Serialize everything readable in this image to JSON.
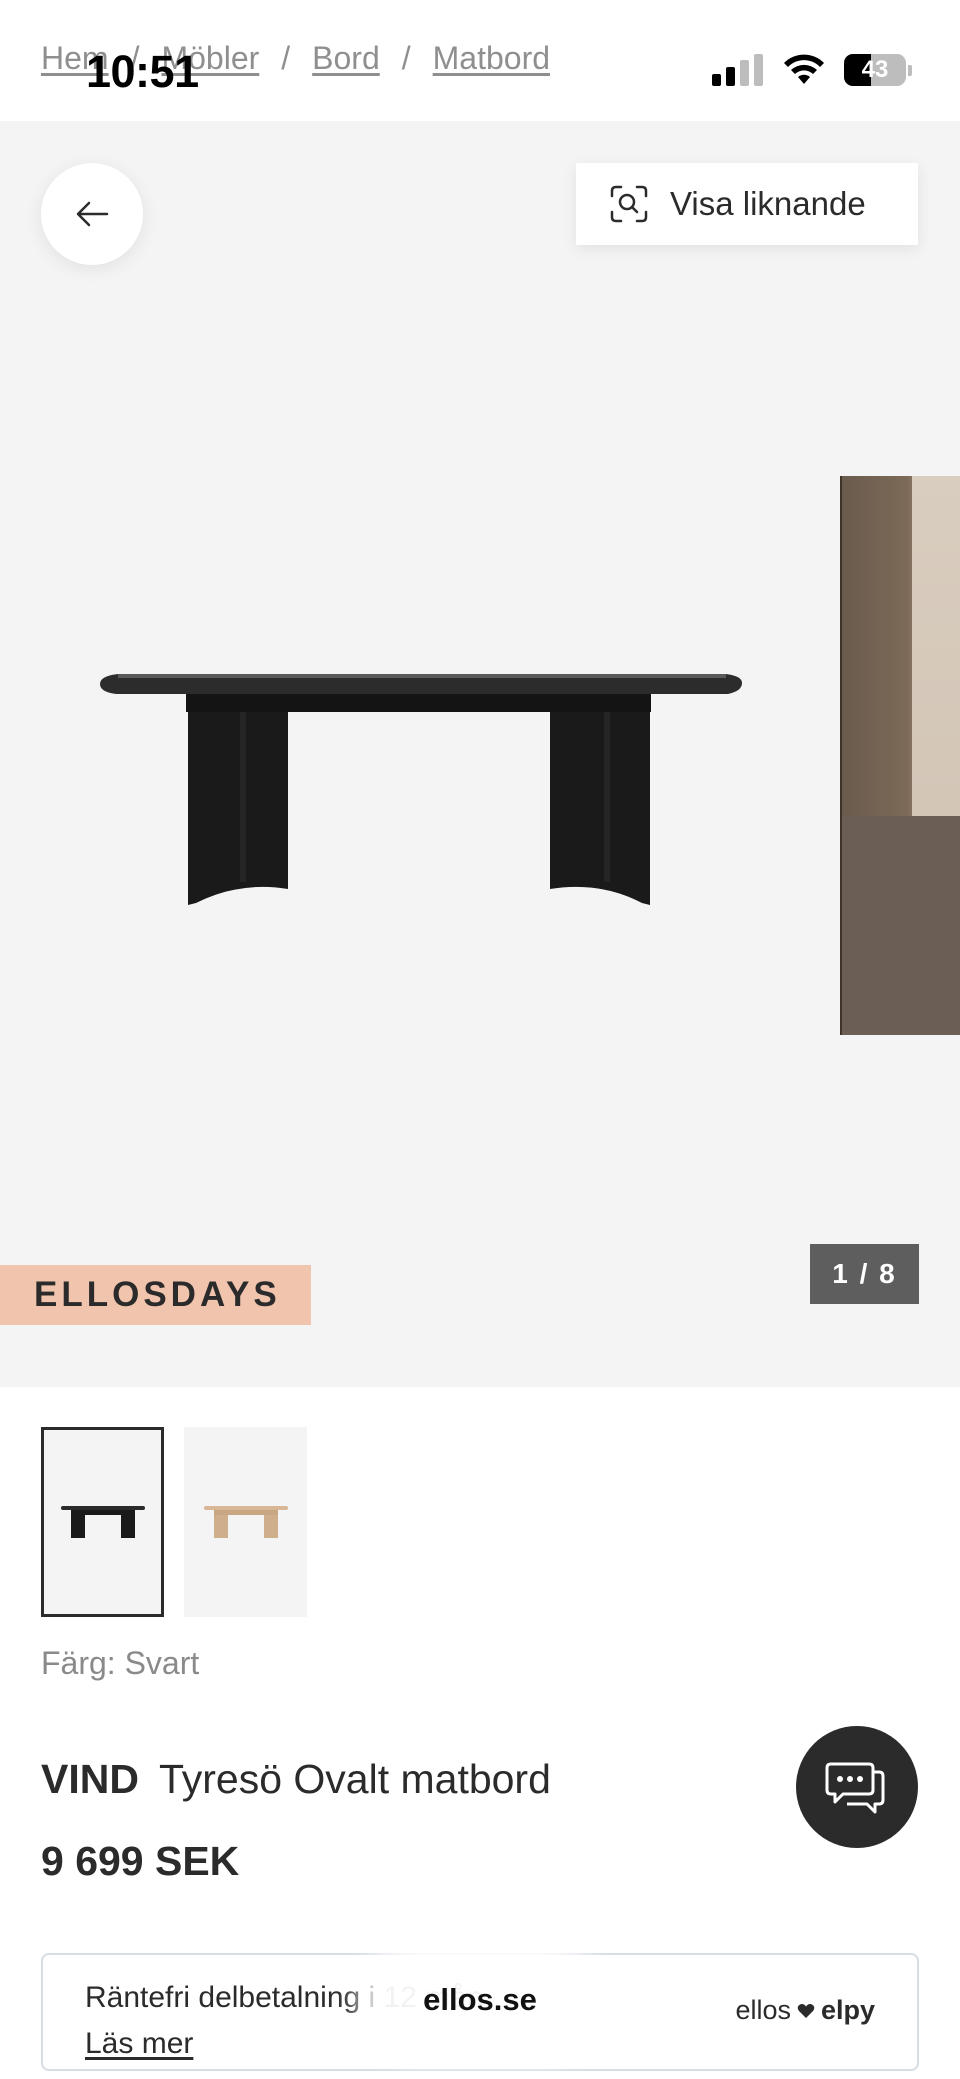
{
  "status_bar": {
    "time": "10:51",
    "battery": "43"
  },
  "breadcrumb": [
    {
      "label": "Hem"
    },
    {
      "label": "Möbler"
    },
    {
      "label": "Bord"
    },
    {
      "label": "Matbord"
    }
  ],
  "breadcrumb_separator": "/",
  "gallery": {
    "back_icon": "arrow-left-icon",
    "similar_label": "Visa liknande",
    "similar_icon": "visual-search-icon",
    "promo_badge": "ELLOSDAYS",
    "counter": "1 / 8"
  },
  "thumbnails": [
    {
      "color": "Svart",
      "selected": true
    },
    {
      "color": "Natur",
      "selected": false
    }
  ],
  "color_selection": "Färg: Svart",
  "product": {
    "brand": "VIND",
    "name": "Tyresö Ovalt matbord",
    "price": "9 699 SEK"
  },
  "chat": {
    "icon": "chat-bubbles-icon"
  },
  "finance": {
    "text": "Räntefri delbetalning i 12 mån.",
    "link": "Läs mer",
    "logo_left": "ellos",
    "logo_right": "elpy"
  },
  "browser": {
    "url": "ellos.se"
  },
  "colors": {
    "badge": "#f0c4ad",
    "counter_bg": "#5e5e5e",
    "gallery_bg": "#f4f4f4",
    "text": "#2b2b2b"
  }
}
